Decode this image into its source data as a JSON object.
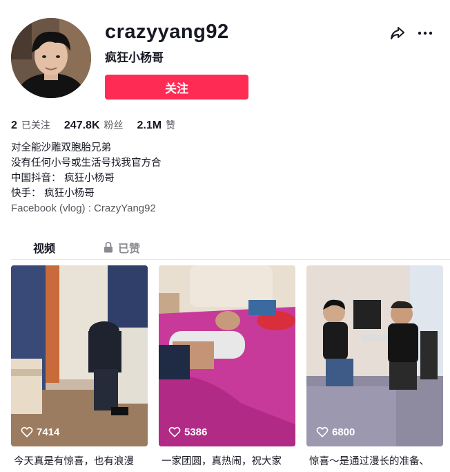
{
  "profile": {
    "username": "crazyyang92",
    "nickname": "疯狂小杨哥",
    "follow_label": "关注"
  },
  "stats": [
    {
      "value": "2",
      "label": "已关注"
    },
    {
      "value": "247.8K",
      "label": "粉丝"
    },
    {
      "value": "2.1M",
      "label": "赞"
    }
  ],
  "bio": [
    "对全能沙雕双胞胎兄弟",
    "没有任何小号或生活号找我官方合",
    "中国抖音： 疯狂小杨哥",
    "快手： 疯狂小杨哥",
    "Facebook (vlog) : CrazyYang92"
  ],
  "tabs": {
    "videos": "视频",
    "liked": "已赞"
  },
  "videos": [
    {
      "likes": "7414",
      "caption": "今天真是有惊喜，也有浪漫"
    },
    {
      "likes": "5386",
      "caption": "一家团圆，真热闹，祝大家"
    },
    {
      "likes": "6800",
      "caption": "惊喜～是通过漫长的准备、"
    }
  ],
  "colors": {
    "accent": "#fe2c55",
    "text": "#161823",
    "muted": "#57575e"
  },
  "icons": [
    "share-icon",
    "more-icon",
    "lock-icon",
    "heart-outline-icon"
  ]
}
